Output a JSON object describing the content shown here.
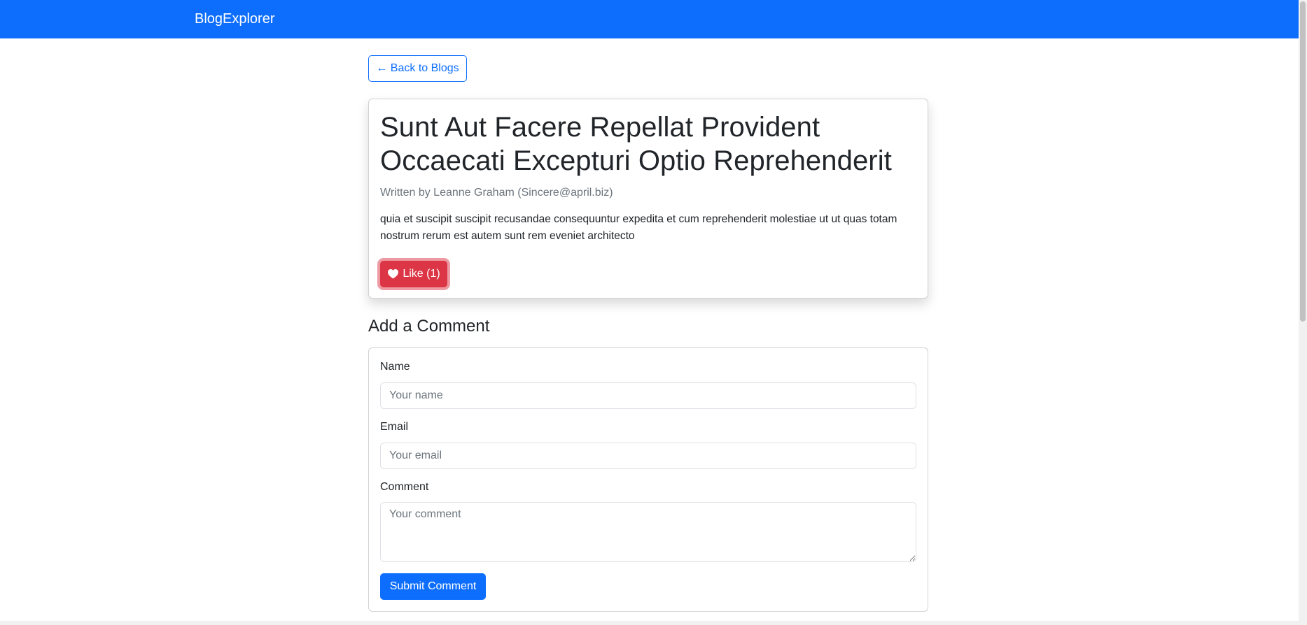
{
  "colors": {
    "accent": "#0d6efd",
    "danger": "#dc3545"
  },
  "navbar": {
    "brand": "BlogExplorer"
  },
  "back_button": {
    "label": "← Back to Blogs"
  },
  "post": {
    "title": "Sunt Aut Facere Repellat Provident Occaecati Excepturi Optio Reprehenderit",
    "meta": "Written by Leanne Graham (Sincere@april.biz)",
    "body": "quia et suscipit suscipit recusandae consequuntur expedita et cum reprehenderit molestiae ut ut quas totam nostrum rerum est autem sunt rem eveniet architecto",
    "like_label": "Like (1)",
    "like_icon": "heart-icon"
  },
  "comment_form": {
    "heading": "Add a Comment",
    "name_label": "Name",
    "name_placeholder": "Your name",
    "email_label": "Email",
    "email_placeholder": "Your email",
    "comment_label": "Comment",
    "comment_placeholder": "Your comment",
    "submit_label": "Submit Comment"
  }
}
